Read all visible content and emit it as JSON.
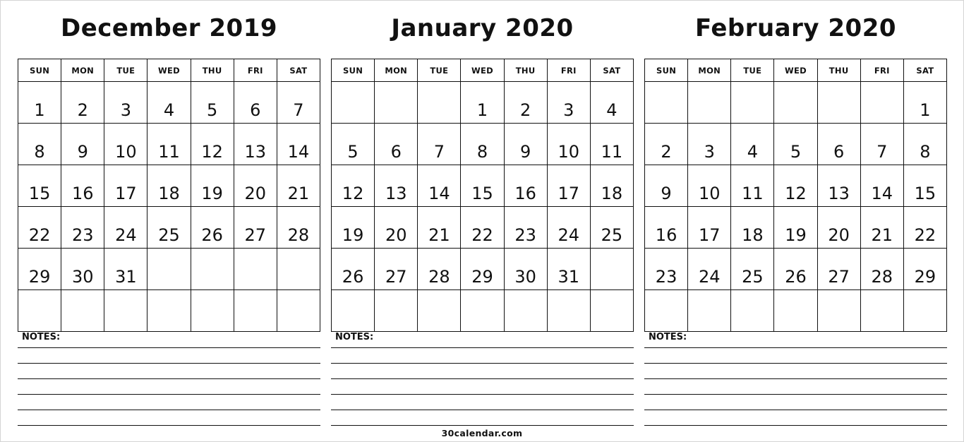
{
  "weekdays": [
    "SUN",
    "MON",
    "TUE",
    "WED",
    "THU",
    "FRI",
    "SAT"
  ],
  "notes_label": "NOTES:",
  "footer": "30calendar.com",
  "months": [
    {
      "title": "December 2019",
      "weeks": [
        [
          "1",
          "2",
          "3",
          "4",
          "5",
          "6",
          "7"
        ],
        [
          "8",
          "9",
          "10",
          "11",
          "12",
          "13",
          "14"
        ],
        [
          "15",
          "16",
          "17",
          "18",
          "19",
          "20",
          "21"
        ],
        [
          "22",
          "23",
          "24",
          "25",
          "26",
          "27",
          "28"
        ],
        [
          "29",
          "30",
          "31",
          "",
          "",
          "",
          ""
        ],
        [
          "",
          "",
          "",
          "",
          "",
          "",
          ""
        ]
      ]
    },
    {
      "title": "January 2020",
      "weeks": [
        [
          "",
          "",
          "",
          "1",
          "2",
          "3",
          "4"
        ],
        [
          "5",
          "6",
          "7",
          "8",
          "9",
          "10",
          "11"
        ],
        [
          "12",
          "13",
          "14",
          "15",
          "16",
          "17",
          "18"
        ],
        [
          "19",
          "20",
          "21",
          "22",
          "23",
          "24",
          "25"
        ],
        [
          "26",
          "27",
          "28",
          "29",
          "30",
          "31",
          ""
        ],
        [
          "",
          "",
          "",
          "",
          "",
          "",
          ""
        ]
      ]
    },
    {
      "title": "February 2020",
      "weeks": [
        [
          "",
          "",
          "",
          "",
          "",
          "",
          "1"
        ],
        [
          "2",
          "3",
          "4",
          "5",
          "6",
          "7",
          "8"
        ],
        [
          "9",
          "10",
          "11",
          "12",
          "13",
          "14",
          "15"
        ],
        [
          "16",
          "17",
          "18",
          "19",
          "20",
          "21",
          "22"
        ],
        [
          "23",
          "24",
          "25",
          "26",
          "27",
          "28",
          "29"
        ],
        [
          "",
          "",
          "",
          "",
          "",
          "",
          ""
        ]
      ]
    }
  ]
}
